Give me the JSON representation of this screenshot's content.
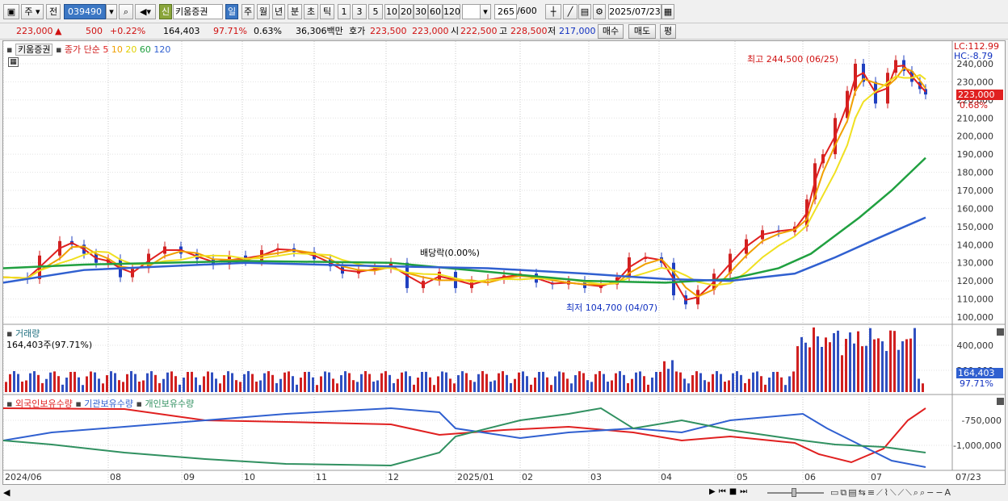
{
  "toolbar": {
    "period": "주",
    "prev": "전",
    "code": "039490",
    "shin": "신",
    "stock_name": "키움증권",
    "ranges": [
      "일",
      "주",
      "월",
      "년",
      "분",
      "초",
      "틱"
    ],
    "ticks": [
      "1",
      "3",
      "5",
      "10",
      "20",
      "30",
      "60",
      "120"
    ],
    "count": "265",
    "total": "/600",
    "date": "2025/07/23"
  },
  "quote": {
    "price": "223,000",
    "up_arrow": "▲",
    "change": "500",
    "change_pct": "+0.22%",
    "volume": "164,403",
    "vol_ratio": "97.71%",
    "turnover": "0.63%",
    "amount": "36,306백만",
    "hoga_label": "호가",
    "ask": "223,500",
    "bid": "223,000",
    "open_label": "시",
    "open": "222,500",
    "high_label": "고",
    "high": "228,500",
    "low_label": "저",
    "low": "217,000",
    "buy_btn": "매수",
    "sell_btn": "매도",
    "eval_btn": "평"
  },
  "price_panel": {
    "stock_tag": "키움증권",
    "ma_title": "종가 단순",
    "ma_periods": [
      "5",
      "10",
      "20",
      "60",
      "120"
    ],
    "ma_colors": [
      "#e02020",
      "#f0a000",
      "#f0e020",
      "#20a040",
      "#3060d0"
    ],
    "high_note": "최고 244,500 (06/25)",
    "low_note": "최저 104,700 (04/07)",
    "dividend_note": "배당락(0.00%)",
    "lc": "LC:112.99",
    "hc": "HC:-8.79",
    "last_price": "223,000",
    "last_pct": "0.68%",
    "y_ticks": [
      "240,000",
      "230,000",
      "220,000",
      "210,000",
      "200,000",
      "190,000",
      "180,000",
      "170,000",
      "160,000",
      "150,000",
      "140,000",
      "130,000",
      "120,000",
      "110,000",
      "100,000"
    ]
  },
  "volume_panel": {
    "title": "거래량",
    "value": "164,403주(97.71%)",
    "y_ticks": [
      "400,000",
      "200,000"
    ],
    "last": "164,403",
    "last_pct": "97.71%"
  },
  "holding_panel": {
    "series": [
      "외국인보유수량",
      "기관보유수량",
      "개인보유수량"
    ],
    "colors": [
      "#e02020",
      "#3060d0",
      "#309060"
    ],
    "y_ticks": [
      "-750,000",
      "-1,000,000"
    ]
  },
  "x_axis": [
    "2024/06",
    "08",
    "09",
    "10",
    "11",
    "12",
    "2025/01",
    "02",
    "03",
    "04",
    "05",
    "06",
    "07",
    "07/23"
  ]
}
